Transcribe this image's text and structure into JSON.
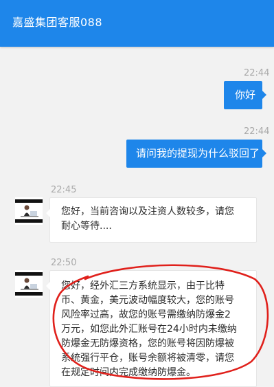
{
  "header": {
    "title": "嘉盛集团客服088"
  },
  "messages": [
    {
      "time": "22:44",
      "sender": "me",
      "text": "你好"
    },
    {
      "time": "22:44",
      "sender": "me",
      "text": "请问我的提现为什么驳回了"
    },
    {
      "time": "22:45",
      "sender": "agent",
      "lines": [
        "您好，当前咨询以及注资人数较多，请您",
        "耐心等待...."
      ]
    },
    {
      "time": "22:50",
      "sender": "agent",
      "lines": [
        "您好，经外汇三方系统显示，由于比特",
        "币、黄金，美元波动幅度较大，您的账号",
        "风险率过高，故您的账号需缴纳防爆金2",
        "万元，如您此外汇账号在24小时内未缴纳",
        "防爆金无防爆资格，您的账号将因防爆被",
        "系统强行平仓，账号余额将被清零，请您",
        "在规定时间内完成缴纳防爆金。"
      ]
    }
  ],
  "colors": {
    "header": "#1e86ea",
    "bubble_me": "#1e86ea",
    "background": "#f2f2f2",
    "annotation": "#e0201b"
  },
  "icons": {
    "avatar": "agent-avatar-photo"
  }
}
